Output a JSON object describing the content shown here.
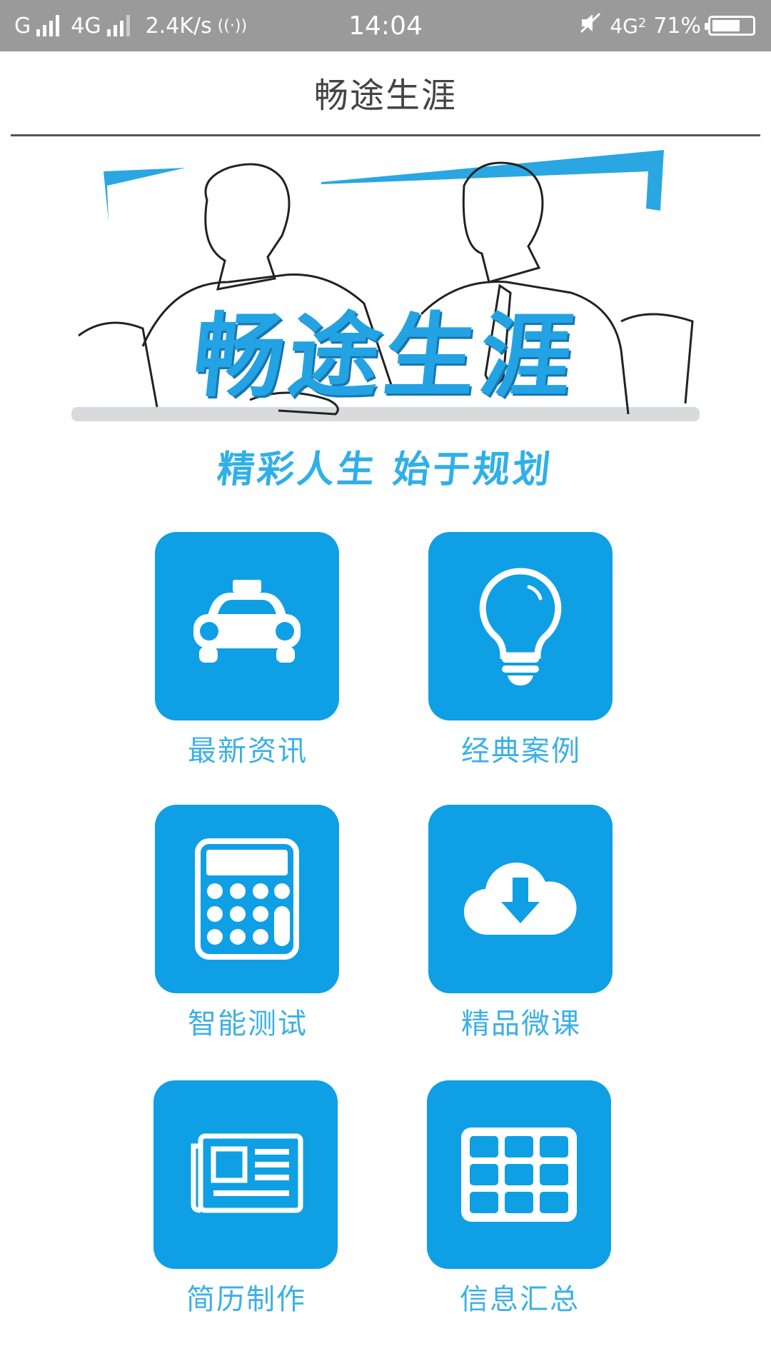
{
  "status_bar": {
    "carrier1": "G",
    "carrier2": "4G",
    "speed": "2.4K/s",
    "time": "14:04",
    "network": "4G",
    "sim_index": "2",
    "battery": "71%",
    "battery_level": 0.71
  },
  "header": {
    "title": "畅途生涯"
  },
  "banner": {
    "title": "畅途生涯",
    "slogan": "精彩人生  始于规划"
  },
  "menu": [
    {
      "label": "最新资讯",
      "icon": "taxi-icon"
    },
    {
      "label": "经典案例",
      "icon": "lightbulb-icon"
    },
    {
      "label": "智能测试",
      "icon": "calculator-icon"
    },
    {
      "label": "精品微课",
      "icon": "cloud-download-icon"
    },
    {
      "label": "简历制作",
      "icon": "newspaper-icon"
    },
    {
      "label": "信息汇总",
      "icon": "grid-table-icon"
    }
  ],
  "colors": {
    "accent": "#0f9fe4",
    "label": "#3bb0e6",
    "status_bar": "#9a9a9a"
  }
}
